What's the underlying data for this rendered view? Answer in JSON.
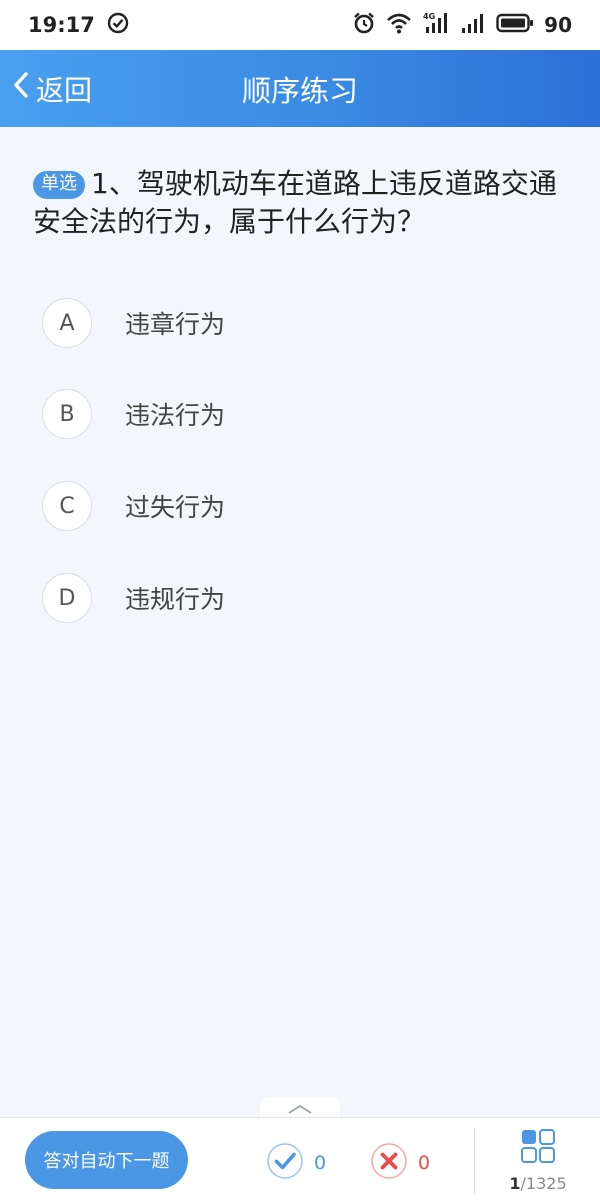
{
  "status_bar": {
    "time": "19:17",
    "network_label": "4G",
    "battery": "90"
  },
  "app_bar": {
    "back_label": "返回",
    "title": "顺序练习"
  },
  "question": {
    "type_badge": "单选",
    "text": "1、驾驶机动车在道路上违反道路交通安全法的行为，属于什么行为？",
    "options": [
      {
        "letter": "A",
        "text": "违章行为"
      },
      {
        "letter": "B",
        "text": "违法行为"
      },
      {
        "letter": "C",
        "text": "过失行为"
      },
      {
        "letter": "D",
        "text": "违规行为"
      }
    ]
  },
  "bottom_bar": {
    "auto_next_label": "答对自动下一题",
    "correct_count": "0",
    "wrong_count": "0",
    "progress_current": "1",
    "progress_total": "/1325"
  },
  "colors": {
    "accent": "#4b97e6",
    "header_gradient_start": "#4a9fef",
    "header_gradient_end": "#2d6fd6",
    "wrong": "#e84c4c",
    "background": "#f3f7fb"
  },
  "icons": {
    "status": [
      "check-circle-icon",
      "alarm-icon",
      "wifi-icon",
      "signal-icon",
      "battery-icon"
    ],
    "app_bar": [
      "chevron-left-icon"
    ],
    "bottom": [
      "chevron-up-icon",
      "check-icon",
      "close-icon",
      "grid-icon"
    ]
  }
}
